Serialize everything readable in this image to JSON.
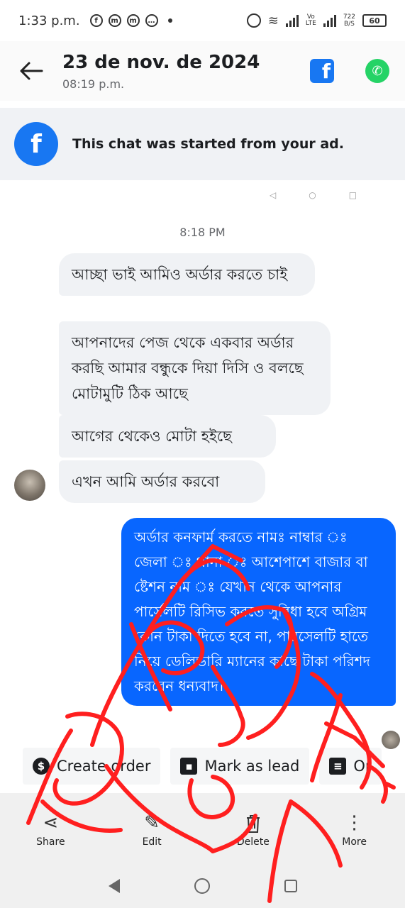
{
  "status_bar": {
    "time": "1:33 p.m.",
    "volte": "Vo\nLTE",
    "speed": "722\nB/S",
    "battery": "60"
  },
  "header": {
    "title": "23 de nov. de 2024",
    "subtitle": "08:19 p.m."
  },
  "banner": {
    "text": "This chat was started from your ad."
  },
  "chat": {
    "timestamp": "8:18 PM",
    "incoming": [
      "আচ্ছা ভাই আমিও অর্ডার করতে চাই",
      "আপনাদের পেজ থেকে একবার অর্ডার করছি আমার বন্ধুকে দিয়া দিসি ও বলছে মোটামুটি ঠিক আছে",
      "আগের থেকেও মোটা হইছে",
      "এখন আমি অর্ডার করবো"
    ],
    "outgoing": "অর্ডার কনফার্ম করতে নামঃ নাম্বার ঃ জেলা ঃ থানা ঃ আশেপাশে বাজার বা ষ্টেশন নাম ঃ যেখান থেকে আপনার পার্সেলটি রিসিভ করতে সুবিধা হবে অগ্রিম কোন টাকা দিতে হবে না, পারসেলটি হাতে নিয়ে ডেলিভারি ম্যানের কাছে টাকা পরিশদ করবেন ধন্যবাদ।"
  },
  "chips": {
    "create_order": "Create order",
    "mark_as_lead": "Mark as lead",
    "third": "Or"
  },
  "toolbar": {
    "share": "Share",
    "edit": "Edit",
    "delete": "Delete",
    "more": "More"
  },
  "colors": {
    "facebook_blue": "#1877f2",
    "messenger_out_bubble": "#0866ff",
    "whatsapp_green": "#25d366",
    "scribble_red": "#ff1f1f"
  },
  "icons": [
    "back-arrow-icon",
    "facebook-icon",
    "whatsapp-icon",
    "dollar-icon",
    "contact-card-icon",
    "share-icon",
    "edit-icon",
    "trash-icon",
    "more-vertical-icon"
  ]
}
